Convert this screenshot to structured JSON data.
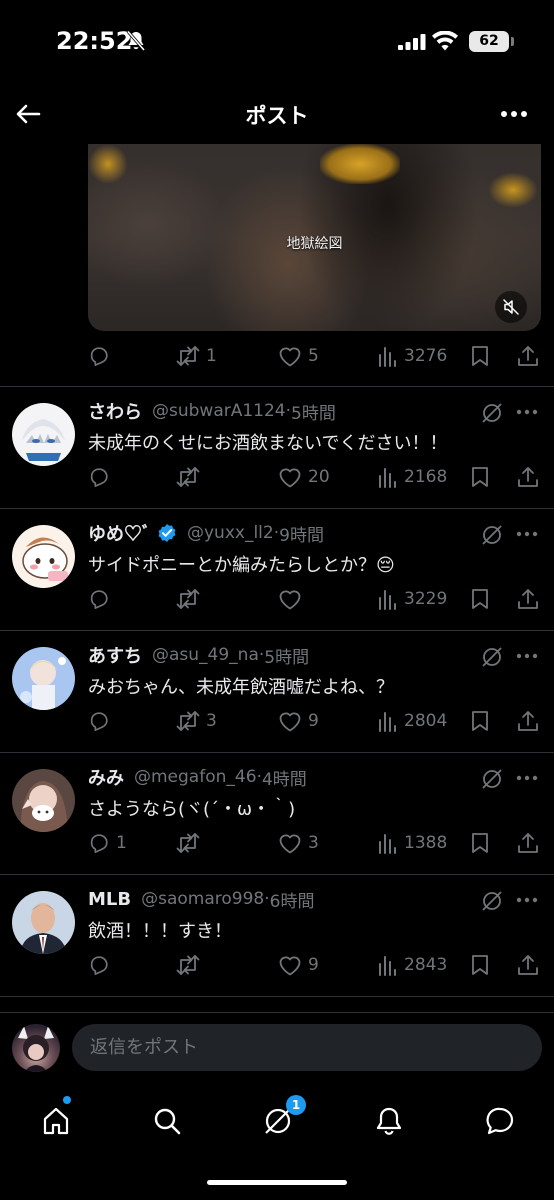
{
  "status_bar": {
    "time": "22:52",
    "battery": "62"
  },
  "header": {
    "title": "ポスト"
  },
  "main_post": {
    "video_caption": "地獄絵図",
    "stats": {
      "reposts": "1",
      "likes": "5",
      "views": "3276"
    }
  },
  "replies": [
    {
      "name": "さわら",
      "handle": "@subwarA1124",
      "time": "5時間",
      "text": "未成年のくせにお酒飲まないでください！！",
      "replies": "",
      "reposts": "",
      "likes": "20",
      "views": "2168"
    },
    {
      "name": "ゆめ♡ﾞ",
      "handle": "@yuxx_ll2",
      "time": "9時間",
      "text": "サイドポニーとか編みたらしとか？😔",
      "replies": "",
      "reposts": "",
      "likes": "",
      "views": "3229",
      "verified": true
    },
    {
      "name": "あすち",
      "handle": "@asu_49_na",
      "time": "5時間",
      "text": "みおちゃん、未成年飲酒嘘だよね、？",
      "replies": "",
      "reposts": "3",
      "likes": "9",
      "views": "2804"
    },
    {
      "name": "みみ",
      "handle": "@megafon_46",
      "time": "4時間",
      "text": "さようなら(ヾ(´・ω・｀)",
      "replies": "1",
      "reposts": "",
      "likes": "3",
      "views": "1388"
    },
    {
      "name": "MLB",
      "handle": "@saomaro998",
      "time": "6時間",
      "text": "飲酒！！！すき！",
      "replies": "",
      "reposts": "",
      "likes": "9",
      "views": "2843"
    }
  ],
  "compose": {
    "placeholder": "返信をポスト"
  },
  "tabbar": {
    "grok_badge": "1"
  },
  "colors": {
    "background": "#000000",
    "text": "#e7e9ea",
    "muted": "#71767b",
    "accent": "#1d9bf0",
    "divider": "#2f3336"
  },
  "icons": [
    "back-arrow-icon",
    "more-icon",
    "reply-icon",
    "repost-icon",
    "like-icon",
    "views-icon",
    "bookmark-icon",
    "share-icon",
    "grok-icon",
    "verified-icon",
    "mute-icon",
    "home-icon",
    "search-icon",
    "grok-tab-icon",
    "bell-icon",
    "messages-icon"
  ]
}
